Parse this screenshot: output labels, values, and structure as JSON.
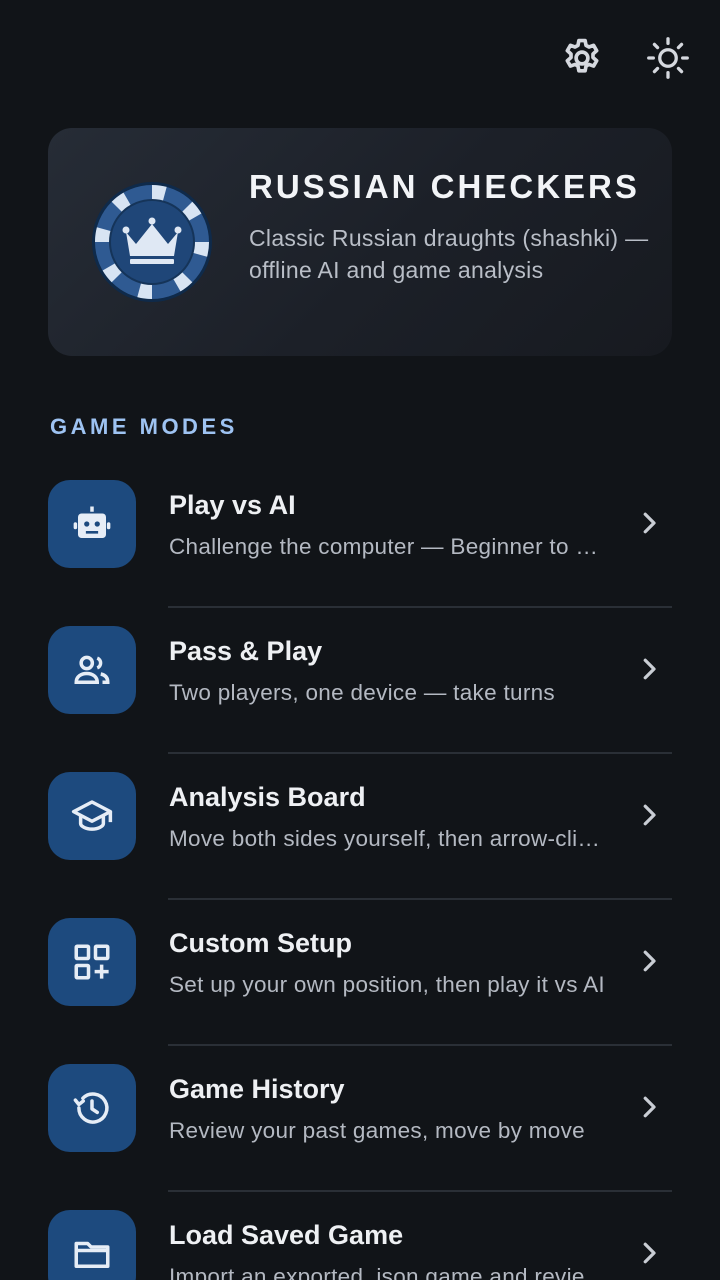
{
  "topbar": {
    "settings_icon": "gear-icon",
    "theme_icon": "sun-icon"
  },
  "hero": {
    "title": "RUSSIAN CHECKERS",
    "subtitle": "Classic Russian draughts (shashki) — offline AI and game analysis",
    "logo_icon": "crown-checker-icon"
  },
  "section": {
    "title": "GAME MODES"
  },
  "modes": [
    {
      "title": "Play vs AI",
      "desc": "Challenge the computer — Beginner to Master",
      "icon": "robot-icon"
    },
    {
      "title": "Pass & Play",
      "desc": "Two players, one device — take turns",
      "icon": "people-icon"
    },
    {
      "title": "Analysis Board",
      "desc": "Move both sides yourself, then arrow-click to analyze",
      "icon": "graduation-cap-icon"
    },
    {
      "title": "Custom Setup",
      "desc": "Set up your own position, then play it vs AI",
      "icon": "grid-plus-icon"
    },
    {
      "title": "Game History",
      "desc": "Review your past games, move by move",
      "icon": "history-icon"
    },
    {
      "title": "Load Saved Game",
      "desc": "Import an exported .json game and review it",
      "icon": "folder-icon"
    }
  ],
  "colors": {
    "background": "#111418",
    "accent_tile": "#1d4a7e",
    "section_label": "#9ec3f2"
  }
}
